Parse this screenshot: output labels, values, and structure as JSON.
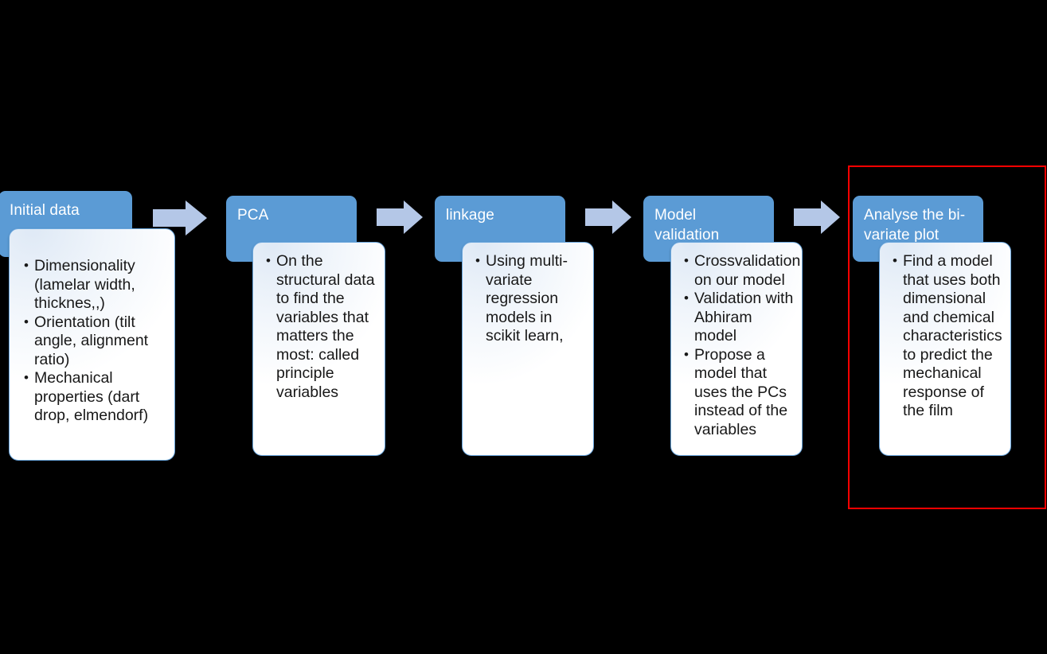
{
  "diagram": {
    "type": "process-flow",
    "background_color": "#000000",
    "accent_color": "#5b9bd5",
    "arrow_color": "#b4c7e7",
    "highlight_color": "#ff0000",
    "steps": [
      {
        "id": "initial-data",
        "title": "Initial data",
        "bullets": [
          "Dimensionality (lamelar width, thicknes,,)",
          "Orientation (tilt angle, alignment ratio)",
          "Mechanical properties (dart drop, elmendorf)"
        ]
      },
      {
        "id": "pca",
        "title": "PCA",
        "bullets": [
          "On the structural data to find the variables that matters the most: called principle variables"
        ]
      },
      {
        "id": "linkage",
        "title": "linkage",
        "bullets": [
          "Using multi-variate regression models in scikit learn,"
        ]
      },
      {
        "id": "model-validation",
        "title": "Model validation",
        "bullets": [
          "Crossvalidation on our model",
          "Validation with Abhiram model",
          "Propose a model that uses the PCs instead of the variables"
        ]
      },
      {
        "id": "analyse-bivariate-plot",
        "title": "Analyse the bi-variate plot",
        "bullets": [
          "Find a model that uses both dimensional and chemical characteristics to predict the mechanical response of the film"
        ]
      }
    ],
    "arrows": [
      {
        "id": "arrow-1",
        "from": "initial-data",
        "to": "pca",
        "icon": "right-arrow-icon"
      },
      {
        "id": "arrow-2",
        "from": "pca",
        "to": "linkage",
        "icon": "right-arrow-icon"
      },
      {
        "id": "arrow-3",
        "from": "linkage",
        "to": "model-validation",
        "icon": "right-arrow-icon"
      },
      {
        "id": "arrow-4",
        "from": "model-validation",
        "to": "analyse-bivariate-plot",
        "icon": "right-arrow-icon"
      }
    ],
    "highlight": {
      "id": "highlight-rect",
      "target": "analyse-bivariate-plot"
    }
  }
}
